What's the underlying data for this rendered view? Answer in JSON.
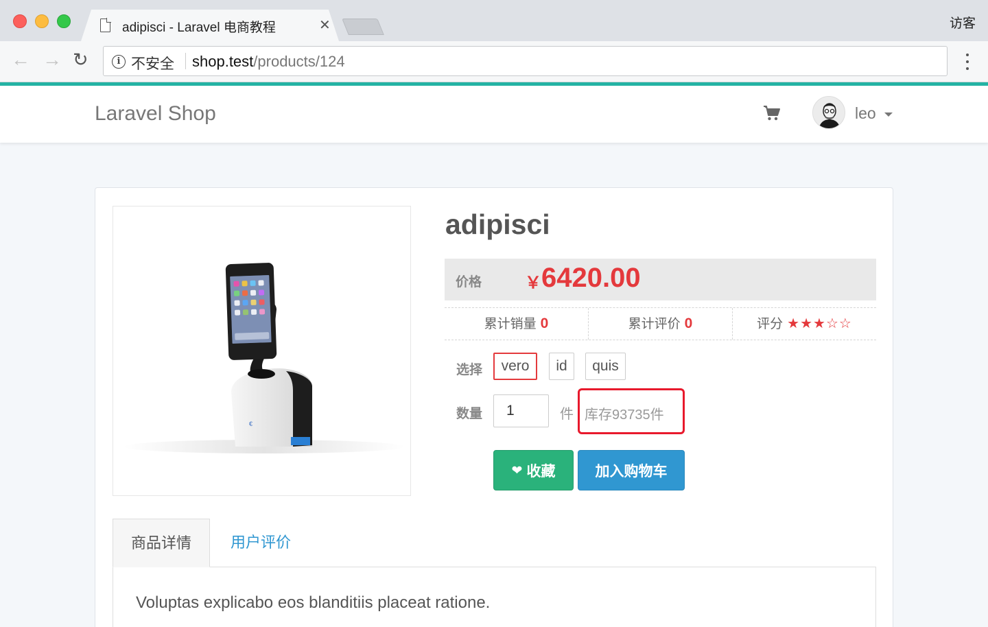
{
  "browser": {
    "tab_title": "adipisci - Laravel 电商教程",
    "tab_close": "✕",
    "guest_label": "访客",
    "insecure_label": "不安全",
    "url_host": "shop.test",
    "url_path": "/products/124"
  },
  "navbar": {
    "brand": "Laravel Shop",
    "user_name": "leo"
  },
  "product": {
    "title": "adipisci",
    "price_label": "价格",
    "currency_symbol": "￥",
    "price": "6420.00",
    "sold_label": "累计销量",
    "sold_count": "0",
    "review_label": "累计评价",
    "review_count": "0",
    "rating_label": "评分",
    "rating_stars": "★★★☆☆",
    "rating_value": 3,
    "sku_label": "选择",
    "skus": [
      {
        "label": "vero",
        "selected": true
      },
      {
        "label": "id",
        "selected": false
      },
      {
        "label": "quis",
        "selected": false
      }
    ],
    "quantity_label": "数量",
    "quantity_value": "1",
    "quantity_unit": "件",
    "stock_text": "库存93735件",
    "favorite_label": "收藏",
    "add_to_cart_label": "加入购物车"
  },
  "tabs": [
    {
      "label": "商品详情",
      "active": true
    },
    {
      "label": "用户评价",
      "active": false
    }
  ],
  "description": "Voluptas explicabo eos blanditiis placeat ratione.",
  "colors": {
    "accent_bar": "#24b3a4",
    "price_red": "#e4393c",
    "favorite_green": "#2ab27b",
    "cart_blue": "#3097d1"
  }
}
